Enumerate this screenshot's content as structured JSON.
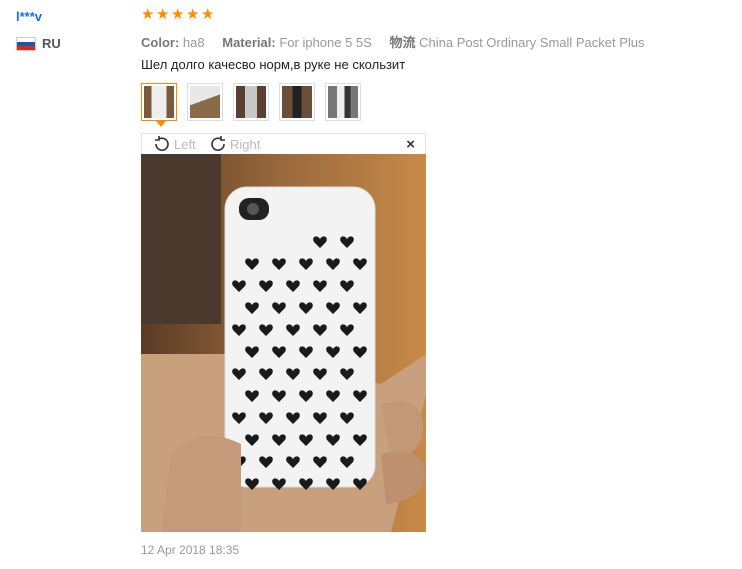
{
  "reviewer": {
    "name": "l***v",
    "country": "RU"
  },
  "rating": {
    "stars": 5,
    "color": "#ff8c00"
  },
  "attributes": {
    "color_label": "Color:",
    "color_value": "ha8",
    "material_label": "Material:",
    "material_value": "For iphone 5 5S",
    "shipping_label": "物流",
    "shipping_value": "China Post Ordinary Small Packet Plus"
  },
  "feedback_text": "Шел долго качесво норм,в руке не скользит",
  "thumbnails": [
    {
      "icon": "phone-case-photo-1"
    },
    {
      "icon": "phone-case-photo-2"
    },
    {
      "icon": "phone-case-photo-3"
    },
    {
      "icon": "phone-case-photo-4"
    },
    {
      "icon": "phone-case-photo-5"
    }
  ],
  "viewer": {
    "rotate_left": "Left",
    "rotate_right": "Right",
    "close": "×"
  },
  "date": "12 Apr 2018 18:35"
}
